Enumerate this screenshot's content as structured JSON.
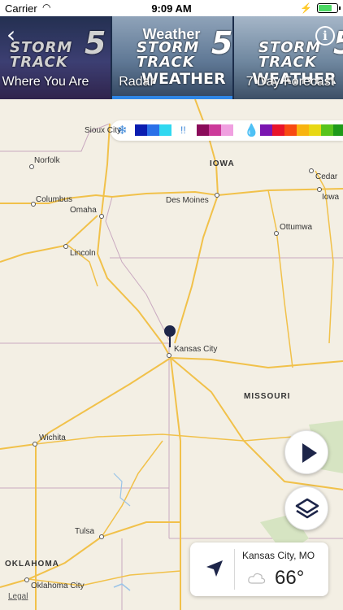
{
  "status_bar": {
    "carrier": "Carrier",
    "time": "9:09 AM",
    "battery_level": 0.8
  },
  "nav": {
    "title": "Weather",
    "back_icon": "chevron-left-icon",
    "info_icon": "info-icon",
    "banner_texts": {
      "storm": "STORM",
      "track": "TRACK",
      "five": "5",
      "weather": "WEATHER"
    }
  },
  "tabs": [
    {
      "label": "Where You Are",
      "selected": false
    },
    {
      "label": "Radar",
      "selected": true
    },
    {
      "label": "7 Day Forecast",
      "selected": false
    }
  ],
  "tab_indicator_color": "#2e86e6",
  "legend": {
    "snow_icon": "snowflake-icon",
    "mix_icon": "sleet-icon",
    "rain_icon": "raindrop-icon",
    "snow_colors": [
      "#0a1db0",
      "#2a70e8",
      "#30d8f0"
    ],
    "mix_colors": [
      "#8a0c5a",
      "#cc3a9a",
      "#f0a0e0"
    ],
    "rain_colors": [
      "#7a16b0",
      "#e8142a",
      "#f84a12",
      "#f8b410",
      "#e8d814",
      "#58c41c",
      "#1e9a1a"
    ]
  },
  "map": {
    "states": [
      "IOWA",
      "MISSOURI",
      "OKLAHOMA"
    ],
    "cities": [
      "Sioux City",
      "Norfolk",
      "Columbus",
      "Omaha",
      "Lincoln",
      "Des Moines",
      "Cedar",
      "Iowa",
      "Ottumwa",
      "Kansas City",
      "Wichita",
      "Tulsa",
      "Oklahoma City"
    ],
    "legal": "Legal"
  },
  "controls": {
    "play_icon": "play-icon",
    "layers_icon": "layers-icon"
  },
  "location_card": {
    "city": "Kansas City, MO",
    "temp": "66°",
    "condition_icon": "cloud-icon",
    "locate_icon": "location-arrow-icon"
  }
}
